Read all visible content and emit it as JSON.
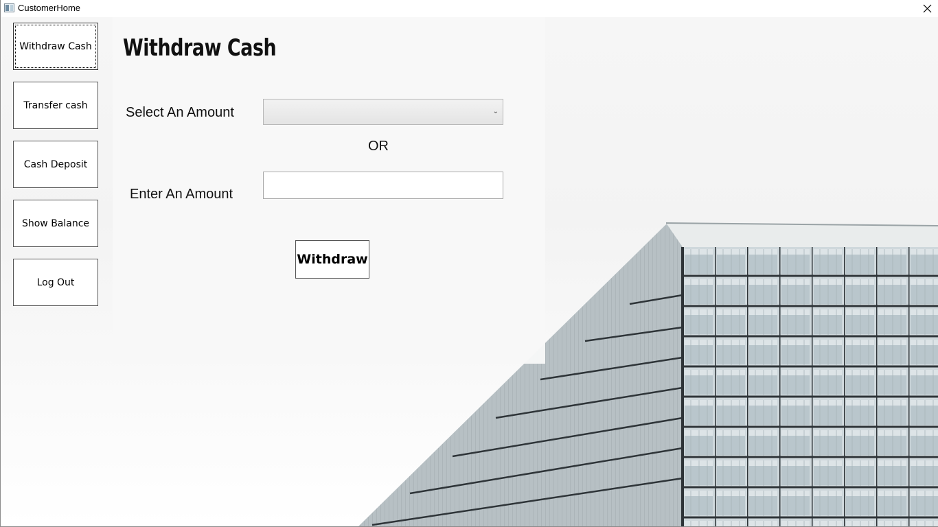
{
  "window": {
    "title": "CustomerHome"
  },
  "icons": {
    "app": "app-window-icon",
    "close": "close-icon",
    "dropdown": "chevron-down-icon"
  },
  "nav": {
    "items": [
      {
        "label": "Withdraw Cash",
        "active": true
      },
      {
        "label": "Transfer cash",
        "active": false
      },
      {
        "label": "Cash Deposit",
        "active": false
      },
      {
        "label": "Show Balance",
        "active": false
      },
      {
        "label": "Log Out",
        "active": false
      }
    ]
  },
  "main": {
    "title": "Withdraw Cash",
    "select_label": "Select An Amount",
    "select_value": "",
    "or_text": "OR",
    "enter_label": "Enter An Amount",
    "amount_value": "",
    "submit_label": "Withdraw"
  },
  "colors": {
    "panel_bg": "#f8f8f8",
    "building_glass": "#c9d3d8",
    "building_frame": "#2e3438"
  }
}
